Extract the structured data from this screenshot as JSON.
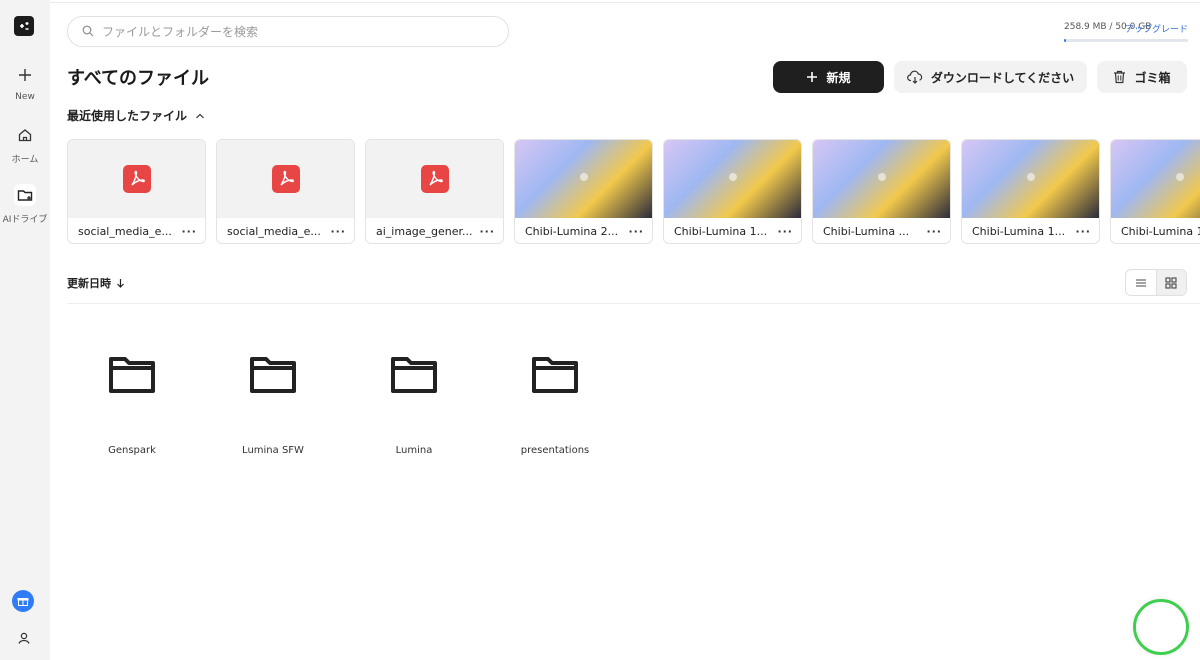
{
  "sidebar": {
    "new_label": "New",
    "home_label": "ホーム",
    "drive_label": "AIドライブ"
  },
  "search": {
    "placeholder": "ファイルとフォルダーを検索"
  },
  "storage": {
    "used_text": "258.9 MB / 50.0 GB",
    "upgrade_label": "アップグレード",
    "used_fraction": 0.005
  },
  "header": {
    "title": "すべてのファイル",
    "new_button": "新規",
    "download_button": "ダウンロードしてください",
    "trash_button": "ゴミ箱"
  },
  "recent": {
    "title": "最近使用したファイル",
    "items": [
      {
        "name": "social_media_e...",
        "type": "pdf"
      },
      {
        "name": "social_media_e...",
        "type": "pdf"
      },
      {
        "name": "ai_image_gener...",
        "type": "pdf"
      },
      {
        "name": "Chibi-Lumina 2...",
        "type": "image"
      },
      {
        "name": "Chibi-Lumina 1...",
        "type": "image"
      },
      {
        "name": "Chibi-Lumina ...",
        "type": "image"
      },
      {
        "name": "Chibi-Lumina 1...",
        "type": "image"
      },
      {
        "name": "Chibi-Lumina 1",
        "type": "image"
      }
    ],
    "more_label": "···"
  },
  "sort": {
    "label": "更新日時"
  },
  "folders": [
    {
      "name": "Genspark"
    },
    {
      "name": "Lumina SFW"
    },
    {
      "name": "Lumina"
    },
    {
      "name": "presentations"
    }
  ],
  "colors": {
    "accent": "#2f7cf6",
    "pdf_red": "#e84545",
    "dark_button": "#1f1f1f",
    "ring_green": "#3fcf4f"
  }
}
